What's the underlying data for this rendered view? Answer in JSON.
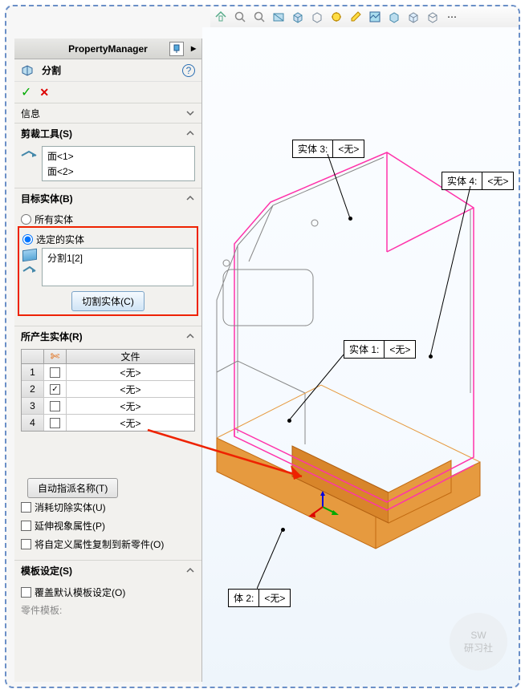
{
  "header": {
    "title": "PropertyManager"
  },
  "feature": {
    "name": "分割",
    "ok": "✓",
    "cancel": "✕",
    "help": "?"
  },
  "sections": {
    "info": {
      "title": "信息"
    },
    "trim": {
      "title": "剪裁工具(S)",
      "items": [
        "面<1>",
        "面<2>"
      ]
    },
    "target": {
      "title": "目标实体(B)",
      "radio_all": "所有实体",
      "radio_sel": "选定的实体",
      "sel_items": [
        "分割1[2]"
      ],
      "cut_button": "切割实体(C)"
    },
    "resulting": {
      "title": "所产生实体(R)",
      "col_file": "文件",
      "rows": [
        {
          "n": "1",
          "checked": false,
          "file": "<无>"
        },
        {
          "n": "2",
          "checked": true,
          "file": "<无>"
        },
        {
          "n": "3",
          "checked": false,
          "file": "<无>"
        },
        {
          "n": "4",
          "checked": false,
          "file": "<无>"
        }
      ],
      "auto_button": "自动指派名称(T)",
      "chk_consume": "消耗切除实体(U)",
      "chk_propagate": "延伸视象属性(P)",
      "chk_copycustom": "将自定义属性复制到新零件(O)"
    },
    "template": {
      "title": "模板设定(S)",
      "chk_override": "覆盖默认模板设定(O)",
      "label_parttpl": "零件模板:"
    }
  },
  "callouts": {
    "b1": {
      "label": "实体 1:",
      "value": "<无>"
    },
    "b2": {
      "label": "体 2:",
      "value": "<无>"
    },
    "b3": {
      "label": "实体 3:",
      "value": "<无>"
    },
    "b4": {
      "label": "实体 4:",
      "value": "<无>"
    }
  },
  "watermark": {
    "l1": "SW",
    "l2": "研习社"
  }
}
